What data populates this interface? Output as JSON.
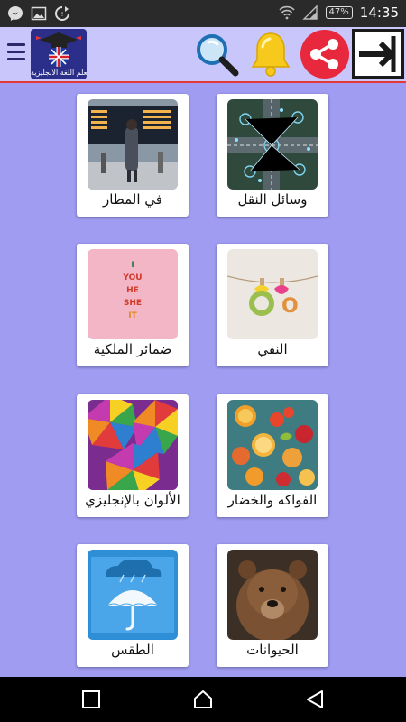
{
  "status_bar": {
    "time": "14:35",
    "battery": "47%"
  },
  "toolbar": {
    "logo_text": "تعلم اللغة الانجليزية",
    "icons": [
      "menu-icon",
      "search-icon",
      "bell-icon",
      "share-icon",
      "exit-icon"
    ]
  },
  "categories": [
    {
      "label": "وسائل النقل"
    },
    {
      "label": "في المطار"
    },
    {
      "label": "النفي"
    },
    {
      "label": "ضمائر الملكية"
    },
    {
      "label": "الفواكه والخضار"
    },
    {
      "label": "الألوان بالإنجليزي"
    },
    {
      "label": "الحيوانات"
    },
    {
      "label": "الطقس"
    }
  ],
  "colors": {
    "background": "#a09cf2",
    "toolbar": "#c9c6fb",
    "accent_line": "#e53935",
    "share_red": "#e8283c",
    "bell_yellow": "#f7c91c"
  }
}
